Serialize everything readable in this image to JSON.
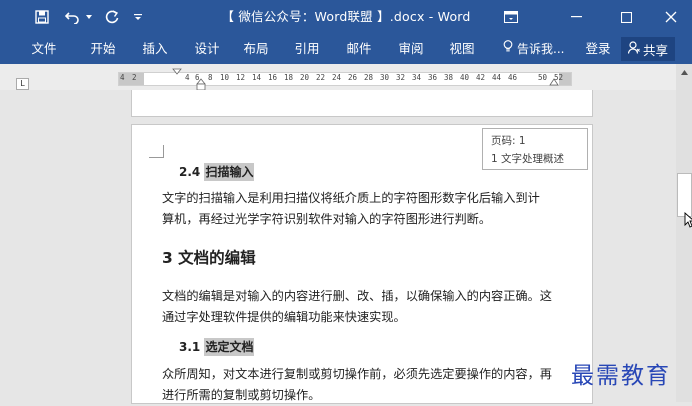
{
  "window": {
    "title": "【 微信公众号：Word联盟 】.docx - Word"
  },
  "ribbon": {
    "tabs": [
      "文件",
      "开始",
      "插入",
      "设计",
      "布局",
      "引用",
      "邮件",
      "审阅",
      "视图"
    ],
    "tell_me": "告诉我...",
    "signin": "登录",
    "share": "共享"
  },
  "ruler": {
    "labels": [
      "4",
      "2",
      "4",
      "6",
      "8",
      "10",
      "12",
      "14",
      "16",
      "18",
      "20",
      "22",
      "24",
      "26",
      "28",
      "30",
      "32",
      "34",
      "36",
      "38",
      "40",
      "42",
      "44",
      "46",
      "50",
      "52"
    ]
  },
  "tooltip": {
    "page": "页码: 1",
    "section": "1 文字处理概述"
  },
  "document": {
    "heading_24_prefix": "2.4 ",
    "heading_24_text": "扫描输入",
    "para1_line1": "文字的扫描输入是利用扫描仪将纸介质上的字符图形数字化后输入到计",
    "para1_line2": "算机，再经过光学字符识别软件对输入的字符图形进行判断。",
    "heading_3": "3 文档的编辑",
    "para2_line1": "文档的编辑是对输入的内容进行删、改、插，以确保输入的内容正确。这",
    "para2_line2": "通过字处理软件提供的编辑功能来快速实现。",
    "heading_31_prefix": "3.1 ",
    "heading_31_text": "选定文档",
    "para3_line1": "众所周知，对文本进行复制或剪切操作前，必须先选定要操作的内容，再",
    "para3_line2": "进行所需的复制或剪切操作。"
  },
  "watermark": "最需教育",
  "colors": {
    "ribbon_blue": "#2b579a",
    "share_blue": "#1e4481",
    "watermark_blue": "#2847b6"
  }
}
